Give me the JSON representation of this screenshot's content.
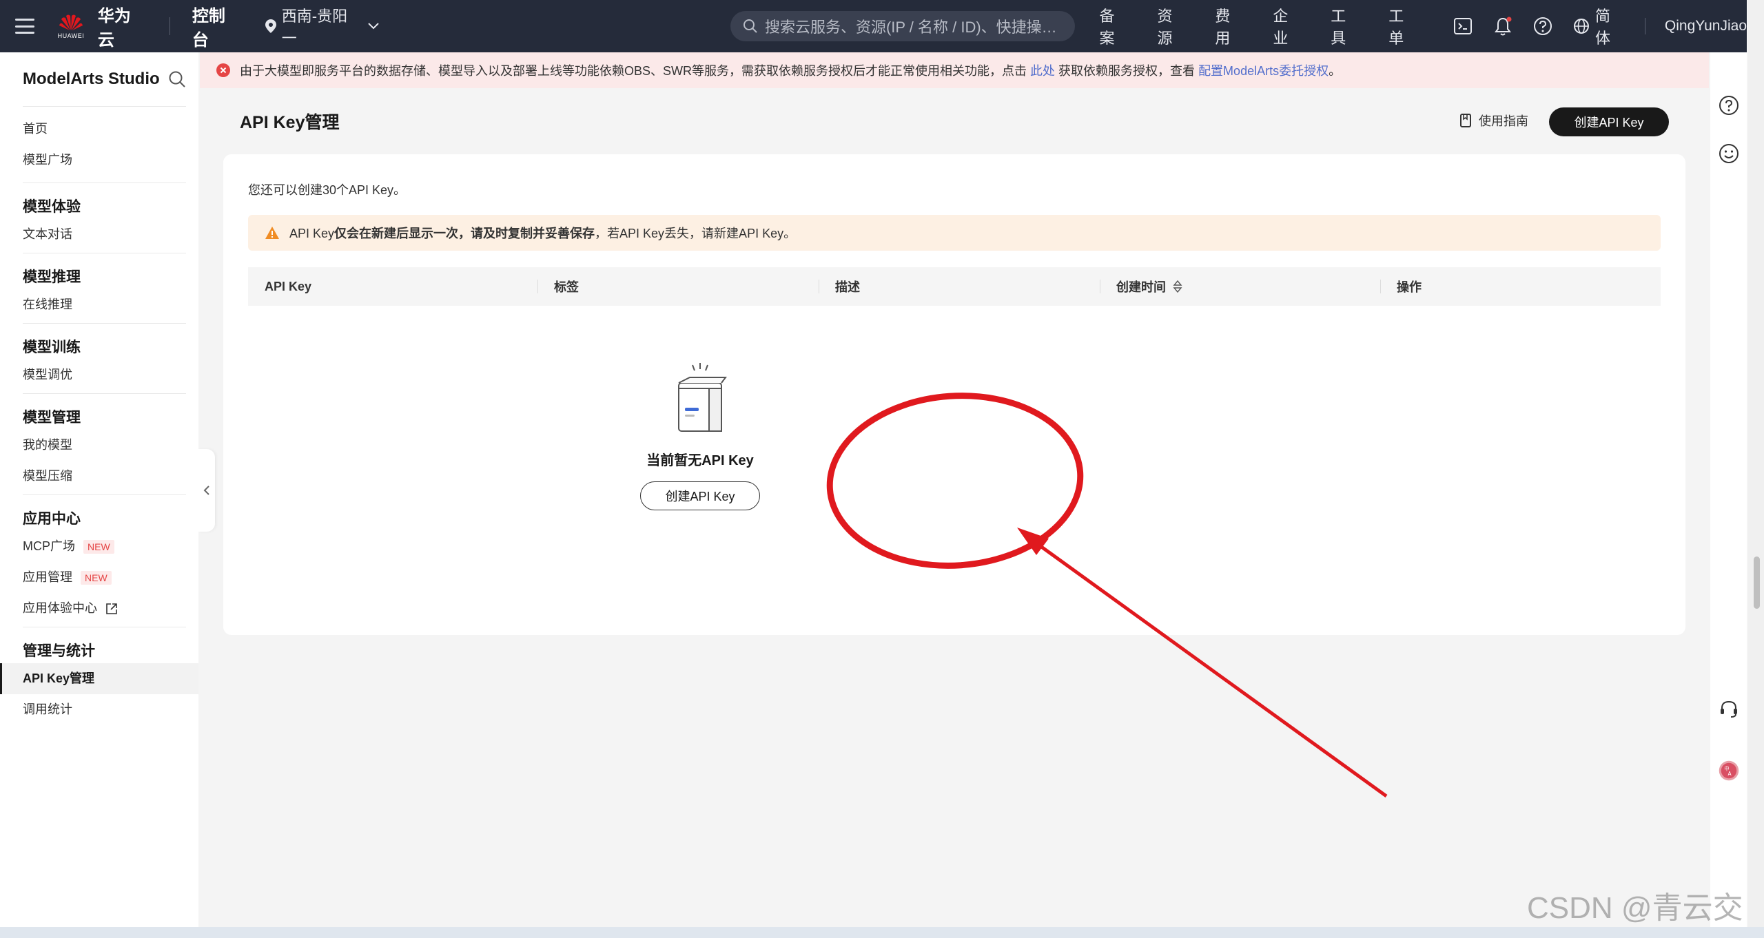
{
  "topbar": {
    "logo_text": "华为云",
    "logo_brand": "HUAWEI",
    "console": "控制台",
    "region": "西南-贵阳一",
    "search_placeholder": "搜索云服务、资源(IP / 名称 / ID)、快捷操作...",
    "nav": [
      "备案",
      "资源",
      "费用",
      "企业",
      "工具",
      "工单"
    ],
    "lang": "简体",
    "user": "QingYunJiao"
  },
  "alert": {
    "text_before": "由于大模型即服务平台的数据存储、模型导入以及部署上线等功能依赖OBS、SWR等服务，需获取依赖服务授权后才能正常使用相关功能，点击",
    "link1": "此处",
    "text_middle": "获取依赖服务授权，查看",
    "link2": "配置ModelArts委托授权",
    "text_end": "。"
  },
  "sidebar": {
    "title": "ModelArts Studio",
    "top_items": [
      "首页",
      "模型广场"
    ],
    "groups": [
      {
        "title": "模型体验",
        "items": [
          "文本对话"
        ]
      },
      {
        "title": "模型推理",
        "items": [
          "在线推理"
        ]
      },
      {
        "title": "模型训练",
        "items": [
          "模型调优"
        ]
      },
      {
        "title": "模型管理",
        "items": [
          "我的模型",
          "模型压缩"
        ]
      },
      {
        "title": "应用中心",
        "items": [
          "MCP广场",
          "应用管理",
          "应用体验中心"
        ]
      },
      {
        "title": "管理与统计",
        "items": [
          "API Key管理",
          "调用统计"
        ]
      }
    ],
    "new_badge": "NEW"
  },
  "page": {
    "title": "API Key管理",
    "guide": "使用指南",
    "create_button": "创建API Key",
    "quota": "您还可以创建30个API Key。",
    "warning_prefix": "API Key",
    "warning_bold": "仅会在新建后显示一次，请及时复制并妥善保存",
    "warning_suffix": "，若API Key丢失，请新建API Key。",
    "columns": [
      "API Key",
      "标签",
      "描述",
      "创建时间",
      "操作"
    ],
    "empty_title": "当前暂无API Key",
    "empty_button": "创建API Key"
  },
  "watermark": "CSDN @青云交",
  "colors": {
    "topbar": "#252b3a",
    "annotation": "#e0191e",
    "link": "#526ecc",
    "alert_bg": "#fbe9e9",
    "warn_bg": "#fdf0e3",
    "warn_icon": "#f08c24",
    "error_icon": "#e54545"
  }
}
